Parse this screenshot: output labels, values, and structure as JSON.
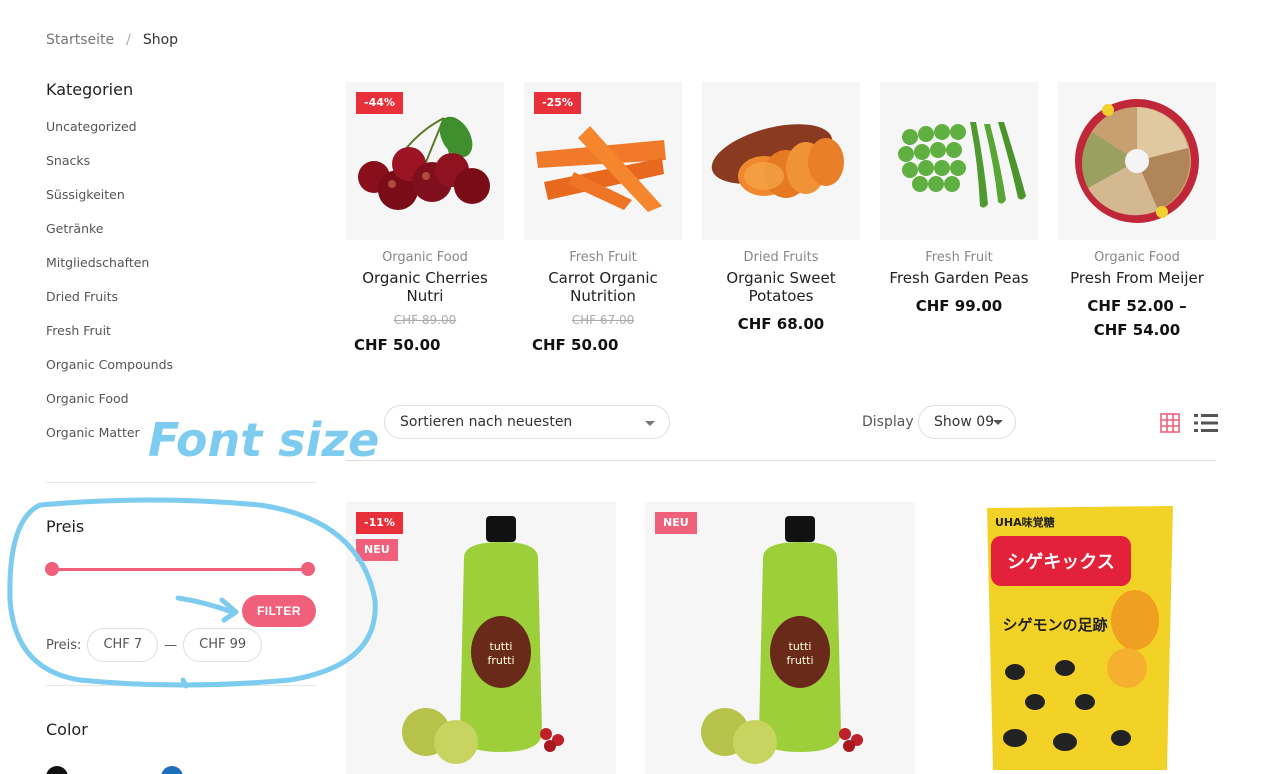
{
  "breadcrumb": {
    "home": "Startseite",
    "separator": "/",
    "current": "Shop"
  },
  "sidebar": {
    "categories_title": "Kategorien",
    "categories": [
      "Uncategorized",
      "Snacks",
      "Süssigkeiten",
      "Getränke",
      "Mitgliedschaften",
      "Dried Fruits",
      "Fresh Fruit",
      "Organic Compounds",
      "Organic Food",
      "Organic Matter"
    ],
    "price_title": "Preis",
    "filter_label": "FILTER",
    "price_label": "Preis:",
    "price_min": "CHF 7",
    "price_dash": "—",
    "price_max": "CHF 99",
    "color_title": "Color"
  },
  "products": [
    {
      "badge": "-44%",
      "category": "Organic Food",
      "name": "Organic Cherries Nutri",
      "old_price": "CHF 89.00",
      "price": "CHF 50.00"
    },
    {
      "badge": "-25%",
      "category": "Fresh Fruit",
      "name": "Carrot Organic Nutrition",
      "old_price": "CHF 67.00",
      "price": "CHF 50.00"
    },
    {
      "badge": "",
      "category": "Dried Fruits",
      "name": "Organic Sweet Potatoes",
      "old_price": "",
      "price": "CHF 68.00"
    },
    {
      "badge": "",
      "category": "Fresh Fruit",
      "name": "Fresh Garden Peas",
      "old_price": "",
      "price": "CHF 99.00"
    },
    {
      "badge": "",
      "category": "Organic Food",
      "name": "Presh From Meijer",
      "old_price": "",
      "price": "CHF 52.00 – CHF 54.00"
    }
  ],
  "toolbar": {
    "sort_value": "Sortieren nach neuesten",
    "display_label": "Display",
    "show_value": "Show 09",
    "grid_icon": "grid-icon",
    "list_icon": "list-icon"
  },
  "lower_products": [
    {
      "badge1": "-11%",
      "badge2": "NEU",
      "label_line1": "tutti",
      "label_line2": "frutti"
    },
    {
      "badge1": "NEU",
      "label_line1": "tutti",
      "label_line2": "frutti"
    },
    {
      "brand": "UHA味覚糖",
      "title": "シゲキックス",
      "subtitle": "シゲモンの足跡"
    }
  ],
  "annotation": {
    "text": "Font size",
    "color": "#7ecbf0"
  },
  "colors": {
    "accent": "#f0607a",
    "sale": "#e8303a"
  }
}
